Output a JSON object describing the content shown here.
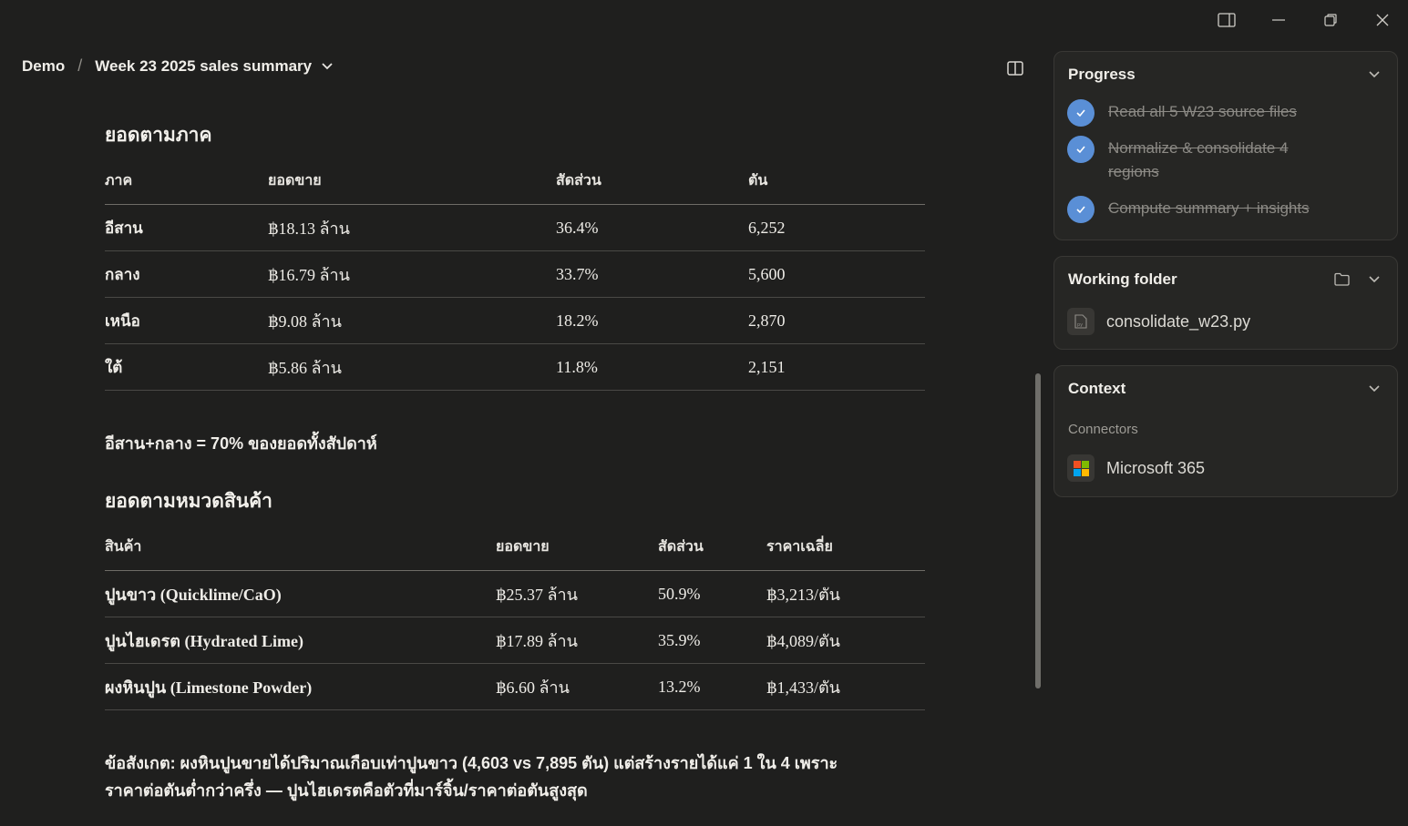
{
  "header": {
    "project": "Demo",
    "separator": "/",
    "title": "Week 23 2025 sales summary"
  },
  "regions_section": {
    "heading": "ยอดตามภาค",
    "columns": [
      "ภาค",
      "ยอดขาย",
      "สัดส่วน",
      "ตัน"
    ],
    "rows": [
      [
        "อีสาน",
        "฿18.13 ล้าน",
        "36.4%",
        "6,252"
      ],
      [
        "กลาง",
        "฿16.79 ล้าน",
        "33.7%",
        "5,600"
      ],
      [
        "เหนือ",
        "฿9.08 ล้าน",
        "18.2%",
        "2,870"
      ],
      [
        "ใต้",
        "฿5.86 ล้าน",
        "11.8%",
        "2,151"
      ]
    ],
    "note": "อีสาน+กลาง = 70% ของยอดทั้งสัปดาห์"
  },
  "products_section": {
    "heading": "ยอดตามหมวดสินค้า",
    "columns": [
      "สินค้า",
      "ยอดขาย",
      "สัดส่วน",
      "ราคาเฉลี่ย"
    ],
    "rows": [
      [
        "ปูนขาว (Quicklime/CaO)",
        "฿25.37 ล้าน",
        "50.9%",
        "฿3,213/ตัน"
      ],
      [
        "ปูนไฮเดรต (Hydrated Lime)",
        "฿17.89 ล้าน",
        "35.9%",
        "฿4,089/ตัน"
      ],
      [
        "ผงหินปูน (Limestone Powder)",
        "฿6.60 ล้าน",
        "13.2%",
        "฿1,433/ตัน"
      ]
    ]
  },
  "observation": {
    "line1": "ข้อสังเกต: ผงหินปูนขายได้ปริมาณเกือบเท่าปูนขาว (4,603 vs 7,895 ตัน) แต่สร้างรายได้แค่ 1 ใน 4 เพราะ",
    "line2": "ราคาต่อตันต่ำกว่าครึ่ง — ปูนไฮเดรตคือตัวที่มาร์จิ้น/ราคาต่อตันสูงสุด"
  },
  "progress": {
    "title": "Progress",
    "steps": [
      {
        "label": "Read all 5 W23 source files",
        "done": true
      },
      {
        "label": "Normalize & consolidate 4 regions",
        "done": true
      },
      {
        "label": "Compute summary + insights",
        "done": true
      }
    ]
  },
  "working_folder": {
    "title": "Working folder",
    "files": [
      {
        "name": "consolidate_w23.py",
        "icon": "python-file-icon"
      }
    ]
  },
  "context": {
    "title": "Context",
    "connectors_label": "Connectors",
    "connectors": [
      {
        "name": "Microsoft 365",
        "icon": "microsoft-logo-icon"
      }
    ]
  },
  "colors": {
    "background": "#1f1f1e",
    "card": "#262624",
    "check": "#5a8fd6"
  }
}
